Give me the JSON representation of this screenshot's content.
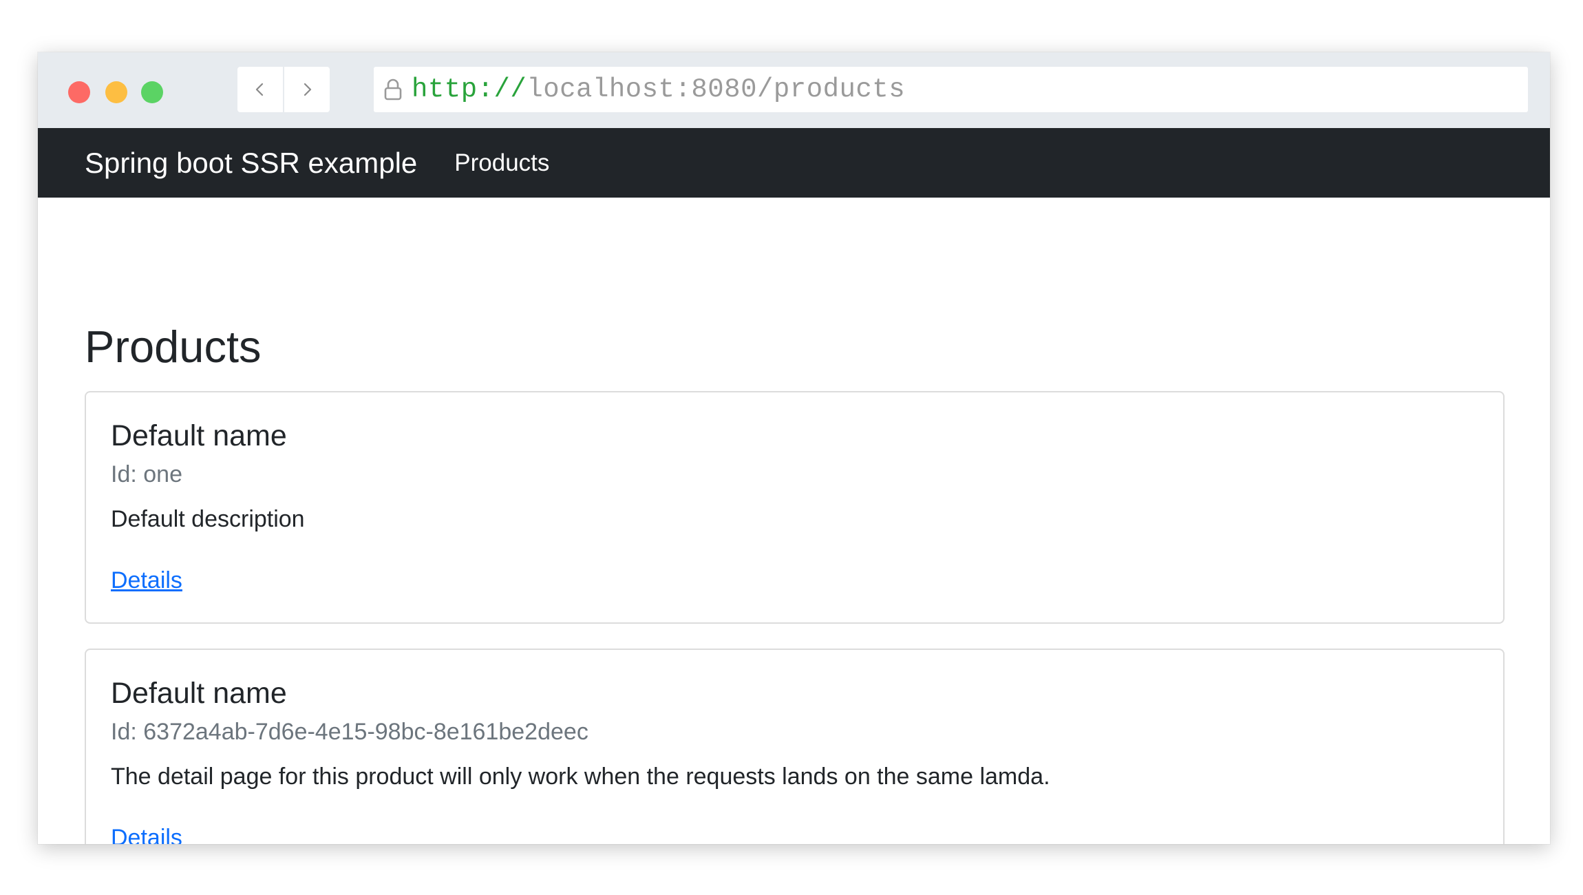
{
  "browser": {
    "url_scheme": "http://",
    "url_rest": "localhost:8080/products",
    "colors": {
      "close": "#fd6a65",
      "minimize": "#fdbe42",
      "maximize": "#5bd364",
      "url_scheme": "#29a33b"
    }
  },
  "navbar": {
    "brand": "Spring boot SSR example",
    "links": [
      {
        "label": "Products"
      }
    ],
    "background": "#212529"
  },
  "main": {
    "title": "Products",
    "cards": [
      {
        "title": "Default name",
        "id_label": "Id: ",
        "id_value": "one",
        "description": "Default description",
        "link_label": "Details"
      },
      {
        "title": "Default name",
        "id_label": "Id: ",
        "id_value": "6372a4ab-7d6e-4e15-98bc-8e161be2deec",
        "description": "The detail page for this product will only work when the requests lands on the same lamda.",
        "link_label": "Details"
      }
    ],
    "link_color": "#0d6efd"
  }
}
